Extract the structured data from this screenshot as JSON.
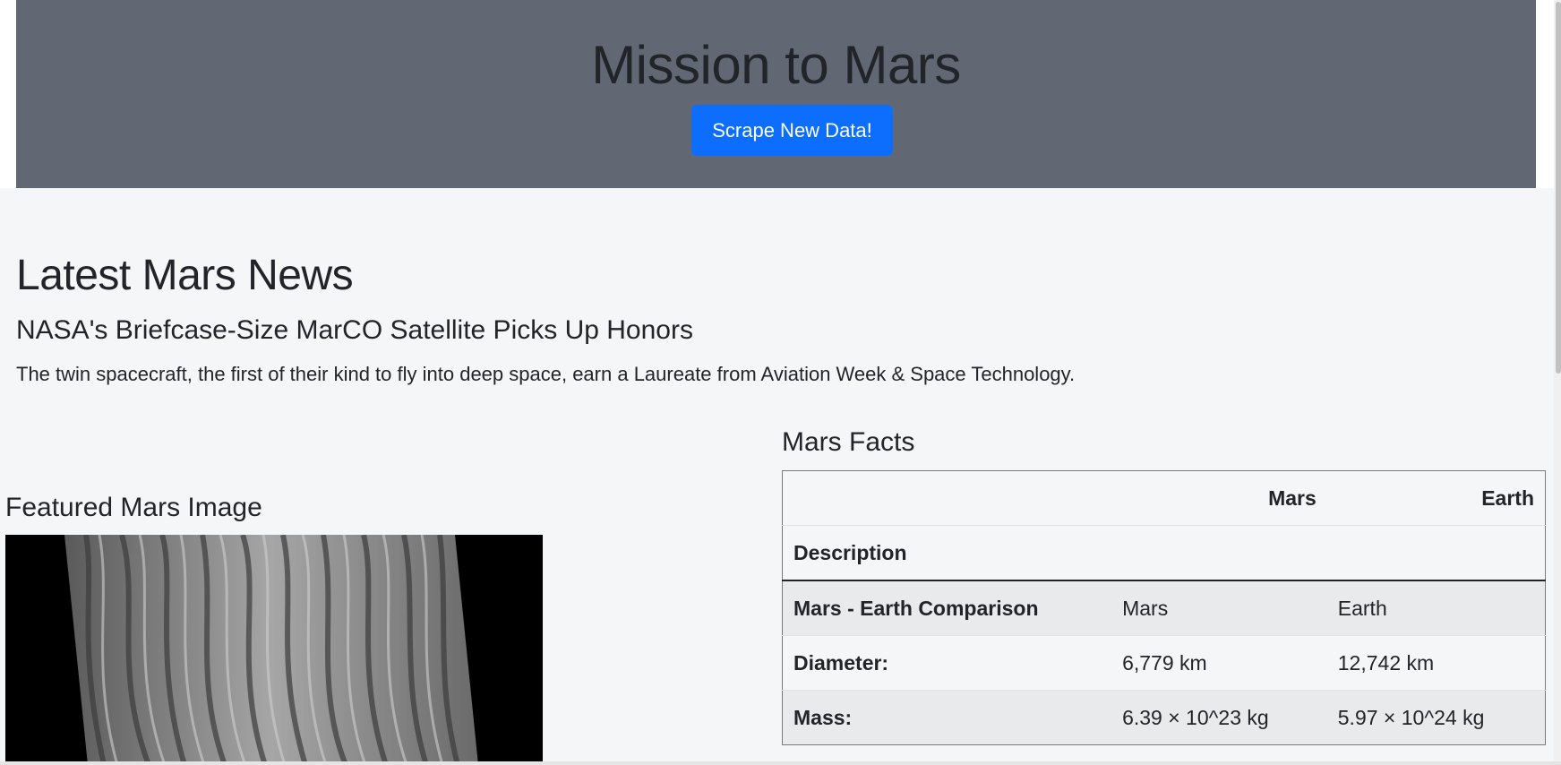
{
  "header": {
    "title": "Mission to Mars",
    "scrape_label": "Scrape New Data!"
  },
  "news": {
    "heading": "Latest Mars News",
    "title": "NASA's Briefcase-Size MarCO Satellite Picks Up Honors",
    "paragraph": "The twin spacecraft, the first of their kind to fly into deep space, earn a Laureate from Aviation Week & Space Technology."
  },
  "featured": {
    "heading": "Featured Mars Image"
  },
  "facts": {
    "heading": "Mars Facts",
    "columns": [
      "Mars",
      "Earth"
    ],
    "index_label": "Description",
    "rows": [
      {
        "label": "Mars - Earth Comparison",
        "mars": "Mars",
        "earth": "Earth"
      },
      {
        "label": "Diameter:",
        "mars": "6,779 km",
        "earth": "12,742 km"
      },
      {
        "label": "Mass:",
        "mars": "6.39 × 10^23 kg",
        "earth": "5.97 × 10^24 kg"
      }
    ]
  },
  "colors": {
    "jumbotron": "#626873",
    "button": "#0d6efd",
    "background": "#f5f6f8"
  }
}
